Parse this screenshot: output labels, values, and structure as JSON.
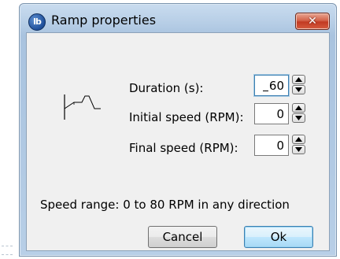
{
  "window": {
    "title": "Ramp properties",
    "app_icon": "lb-logo-icon",
    "close_glyph": "✕"
  },
  "fields": [
    {
      "label": "Duration (s):",
      "value": "60",
      "focused": true
    },
    {
      "label": "Initial speed (RPM):",
      "value": "0",
      "focused": false
    },
    {
      "label": "Final speed (RPM):",
      "value": "0",
      "focused": false
    }
  ],
  "info": "Speed range: 0 to 80 RPM in any direction",
  "buttons": {
    "cancel": "Cancel",
    "ok": "Ok"
  },
  "colors": {
    "titlebar": "#b7cee6",
    "close_button": "#c23a22",
    "client_bg": "#f0f0f0",
    "focus_border": "#3c7fb1"
  }
}
